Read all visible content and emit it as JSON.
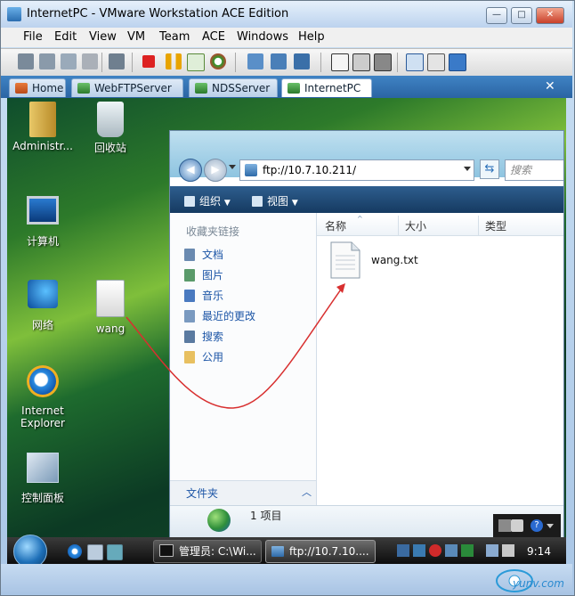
{
  "window": {
    "title": "InternetPC - VMware Workstation ACE Edition",
    "min": "—",
    "max": "□",
    "close": "✕"
  },
  "menu": [
    "File",
    "Edit",
    "View",
    "VM",
    "Team",
    "ACE",
    "Windows",
    "Help"
  ],
  "tabs": {
    "items": [
      "Home",
      "WebFTPServer",
      "NDSServer",
      "InternetPC"
    ],
    "active": "InternetPC",
    "close": "✕"
  },
  "desktop": {
    "icons": [
      "Administr...",
      "回收站",
      "计算机",
      "网络",
      "wang",
      "Internet Explorer",
      "控制面板"
    ]
  },
  "explorer": {
    "address": "ftp://10.7.10.211/",
    "search_placeholder": "搜索",
    "back": "◀",
    "forward": "▶",
    "refresh": "⇆",
    "commands": {
      "organize": "组织",
      "views": "视图"
    },
    "nav_title": "收藏夹链接",
    "nav_items": [
      "文档",
      "图片",
      "音乐",
      "最近的更改",
      "搜索",
      "公用"
    ],
    "folders_label": "文件夹",
    "folders_chevron": "︿",
    "columns": [
      "名称",
      "大小",
      "类型"
    ],
    "file": "wang.txt",
    "item_count": "1 项目",
    "help_glyph": "?"
  },
  "taskbar": {
    "tasks": [
      "管理员: C:\\Wi...",
      "ftp://10.7.10...."
    ],
    "clock": "9:14"
  },
  "colors": {
    "accent": "#2b64a3",
    "link": "#1c55a6",
    "arrow": "#d83030"
  },
  "watermark": "yunv.com"
}
